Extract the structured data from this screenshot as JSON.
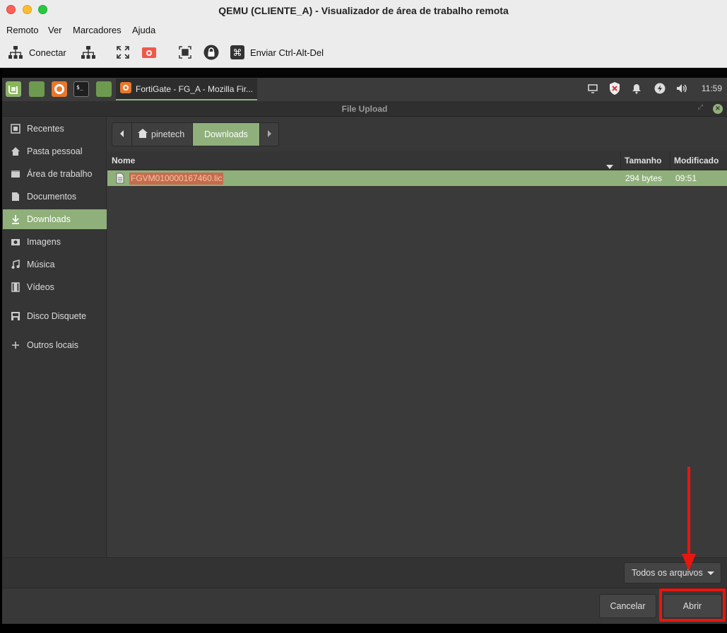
{
  "window": {
    "title": "QEMU (CLIENTE_A) - Visualizador de área de trabalho remota"
  },
  "menu": [
    "Remoto",
    "Ver",
    "Marcadores",
    "Ajuda"
  ],
  "toolbar": {
    "connect_label": "Conectar",
    "send_keys_label": "Enviar Ctrl-Alt-Del",
    "icons": [
      "network-icon",
      "network-icon",
      "fullscreen-icon",
      "screenshot-icon",
      "resize-icon",
      "lock-icon",
      "command-icon"
    ]
  },
  "remote_panel": {
    "task_label": "FortiGate - FG_A - Mozilla Fir...",
    "clock": "11:59"
  },
  "dialog": {
    "title": "File Upload",
    "sidebar": [
      {
        "label": "Recentes",
        "icon": "recent-icon"
      },
      {
        "label": "Pasta pessoal",
        "icon": "home-icon"
      },
      {
        "label": "Área de trabalho",
        "icon": "desktop-icon"
      },
      {
        "label": "Documentos",
        "icon": "document-icon"
      },
      {
        "label": "Downloads",
        "icon": "download-icon",
        "active": true
      },
      {
        "label": "Imagens",
        "icon": "camera-icon"
      },
      {
        "label": "Música",
        "icon": "music-icon"
      },
      {
        "label": "Vídeos",
        "icon": "film-icon"
      },
      {
        "label": "Disco Disquete",
        "icon": "floppy-icon"
      },
      {
        "label": "Outros locais",
        "icon": "plus-icon"
      }
    ],
    "path": {
      "home": "pinetech",
      "current": "Downloads"
    },
    "columns": {
      "name": "Nome",
      "size": "Tamanho",
      "modified": "Modificado"
    },
    "files": [
      {
        "name": "FGVM010000167460.lic",
        "size": "294 bytes",
        "modified": "09:51"
      }
    ],
    "filter": "Todos os arquivos",
    "cancel_label": "Cancelar",
    "open_label": "Abrir"
  },
  "colors": {
    "accent": "#8fb07a",
    "annotation": "#e8160f",
    "dialog_bg": "#383838"
  }
}
